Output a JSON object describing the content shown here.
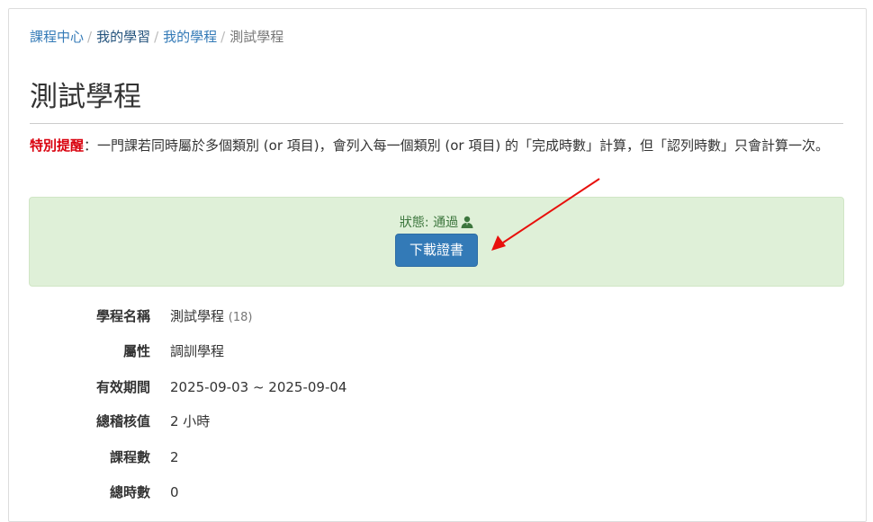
{
  "breadcrumb": {
    "items": [
      "課程中心",
      "我的學習",
      "我的學程"
    ],
    "separator": "/",
    "current": "測試學程"
  },
  "page": {
    "title": "測試學程"
  },
  "notice": {
    "highlight": "特別提醒",
    "text": "：一門課若同時屬於多個類別 (or 項目)，會列入每一個類別 (or 項目) 的「完成時數」計算，但「認列時數」只會計算一次。"
  },
  "status": {
    "label": "狀態: 通過",
    "icon": "user-icon",
    "download_label": "下載證書"
  },
  "details": {
    "name": {
      "label": "學程名稱",
      "value": "測試學程",
      "count": "(18)"
    },
    "attribute": {
      "label": "屬性",
      "value": "調訓學程"
    },
    "period": {
      "label": "有效期間",
      "value": "2025-09-03 ~ 2025-09-04"
    },
    "credit": {
      "label": "總稽核值",
      "value": "2 小時"
    },
    "courses": {
      "label": "課程數",
      "value": "2"
    },
    "hours": {
      "label": "總時數",
      "value": "0"
    }
  },
  "colors": {
    "link": "#337ab7",
    "highlight": "#d9000d",
    "success_bg": "#dff0d8",
    "success_text": "#3c763d",
    "primary_button": "#337ab7",
    "annotation_arrow": "#e8100c"
  }
}
